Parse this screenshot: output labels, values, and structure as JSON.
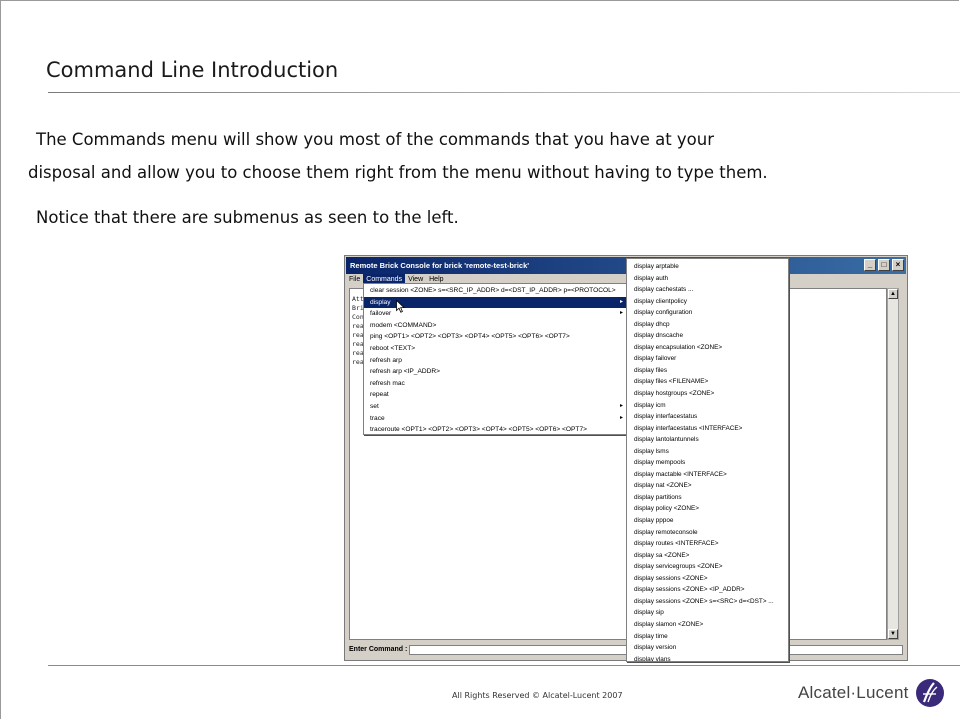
{
  "slide": {
    "title": "Command Line Introduction",
    "para1_line1": "The Commands menu will show you most of the commands that you have at your",
    "para1_line2": "disposal and allow you to choose them right from the menu without having to type them.",
    "para2": "Notice that there are submenus as seen to the left.",
    "footer": "All Rights Reserved © Alcatel-Lucent 2007",
    "logo_text": "Alcatel·Lucent"
  },
  "window": {
    "title": "Remote Brick Console for brick 'remote-test-brick'",
    "menubar": [
      "File",
      "Commands",
      "View",
      "Help"
    ],
    "console_lines": [
      "Att",
      "Bri",
      "Con",
      "rea",
      "rea",
      "rea",
      "rea",
      "rea"
    ],
    "enter_command_label": "Enter Command :",
    "enter_command_value": ""
  },
  "commands_menu": [
    {
      "label": "clear session <ZONE> s=<SRC_IP_ADDR> d=<DST_IP_ADDR> p=<PROTOCOL>",
      "submenu": false
    },
    {
      "label": "display",
      "submenu": true,
      "highlighted": true
    },
    {
      "label": "failover",
      "submenu": true
    },
    {
      "label": "modem <COMMAND>",
      "submenu": false
    },
    {
      "label": "ping <OPT1> <OPT2> <OPT3> <OPT4> <OPT5> <OPT6> <OPT7>",
      "submenu": false
    },
    {
      "label": "reboot <TEXT>",
      "submenu": false
    },
    {
      "label": "refresh arp",
      "submenu": false
    },
    {
      "label": "refresh arp <IP_ADDR>",
      "submenu": false
    },
    {
      "label": "refresh mac",
      "submenu": false
    },
    {
      "label": "repeat",
      "submenu": false
    },
    {
      "label": "set",
      "submenu": true
    },
    {
      "label": "trace",
      "submenu": true
    },
    {
      "label": "traceroute <OPT1> <OPT2> <OPT3> <OPT4> <OPT5> <OPT6> <OPT7>",
      "submenu": false
    }
  ],
  "display_submenu": [
    "display arptable",
    "display auth",
    "display cachestats ...",
    "display clientpolicy",
    "display configuration",
    "display dhcp",
    "display dnscache",
    "display encapsulation <ZONE>",
    "display failover",
    "display files",
    "display files <FILENAME>",
    "display hostgroups <ZONE>",
    "display icm",
    "display interfacestatus",
    "display interfacestatus <INTERFACE>",
    "display lantolantunnels",
    "display lsms",
    "display mempools",
    "display mactable <INTERFACE>",
    "display nat <ZONE>",
    "display partitions",
    "display policy <ZONE>",
    "display pppoe",
    "display remoteconsole",
    "display routes <INTERFACE>",
    "display sa <ZONE>",
    "display servicegroups <ZONE>",
    "display sessions <ZONE>",
    "display sessions <ZONE> <IP_ADDR>",
    "display sessions <ZONE> s=<SRC> d=<DST> ...",
    "display sip",
    "display slamon <ZONE>",
    "display time",
    "display version",
    "display vlans"
  ],
  "icons": {
    "minimize": "minimize-icon",
    "maximize": "maximize-icon",
    "close": "close-icon",
    "submenu_arrow": "chevron-right-icon",
    "logo": "alcatel-lucent-logo"
  },
  "colors": {
    "titlebar": "#0a246a",
    "highlight": "#0a246a"
  }
}
